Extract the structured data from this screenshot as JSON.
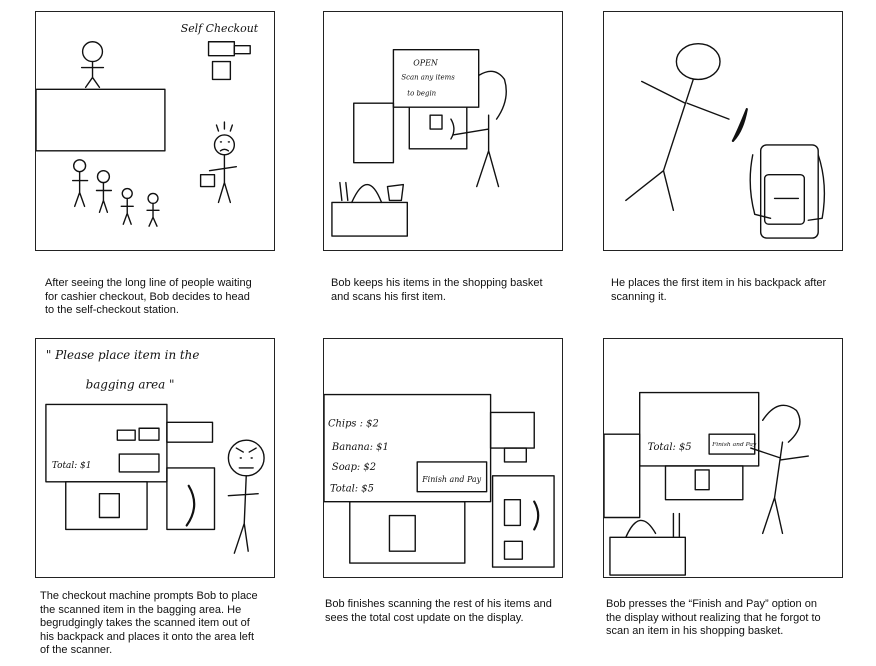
{
  "panels": [
    {
      "caption": "After seeing the long line of people waiting\nfor cashier checkout, Bob decides to head\nto the self-checkout station.",
      "sign_label": "Self Checkout"
    },
    {
      "caption": "Bob keeps his items in the shopping basket\nand scans his first item.",
      "screen_lines": [
        "OPEN",
        "Scan any items",
        "to begin"
      ]
    },
    {
      "caption": "He places the first item in his backpack after\nscanning it."
    },
    {
      "caption": "The checkout machine prompts Bob to place\nthe scanned item in the bagging area. He\nbegrudgingly takes the scanned item out of\nhis backpack and places it onto the area left\nof the scanner.",
      "speech_lines": [
        "\" Please place item in the",
        "bagging area \""
      ],
      "total_label": "Total: $1"
    },
    {
      "caption": "Bob finishes scanning the rest of his items and\nsees the total cost update on the display.",
      "items": [
        "Chips : $2",
        "Banana: $1",
        "Soap: $2",
        "Total: $5"
      ],
      "finish_button": "Finish and Pay"
    },
    {
      "caption": "Bob presses the “Finish and Pay” option on\nthe display without realizing that he forgot to\nscan an item in his shopping basket.",
      "total_label": "Total: $5",
      "finish_button": "Finish and Pay"
    }
  ]
}
